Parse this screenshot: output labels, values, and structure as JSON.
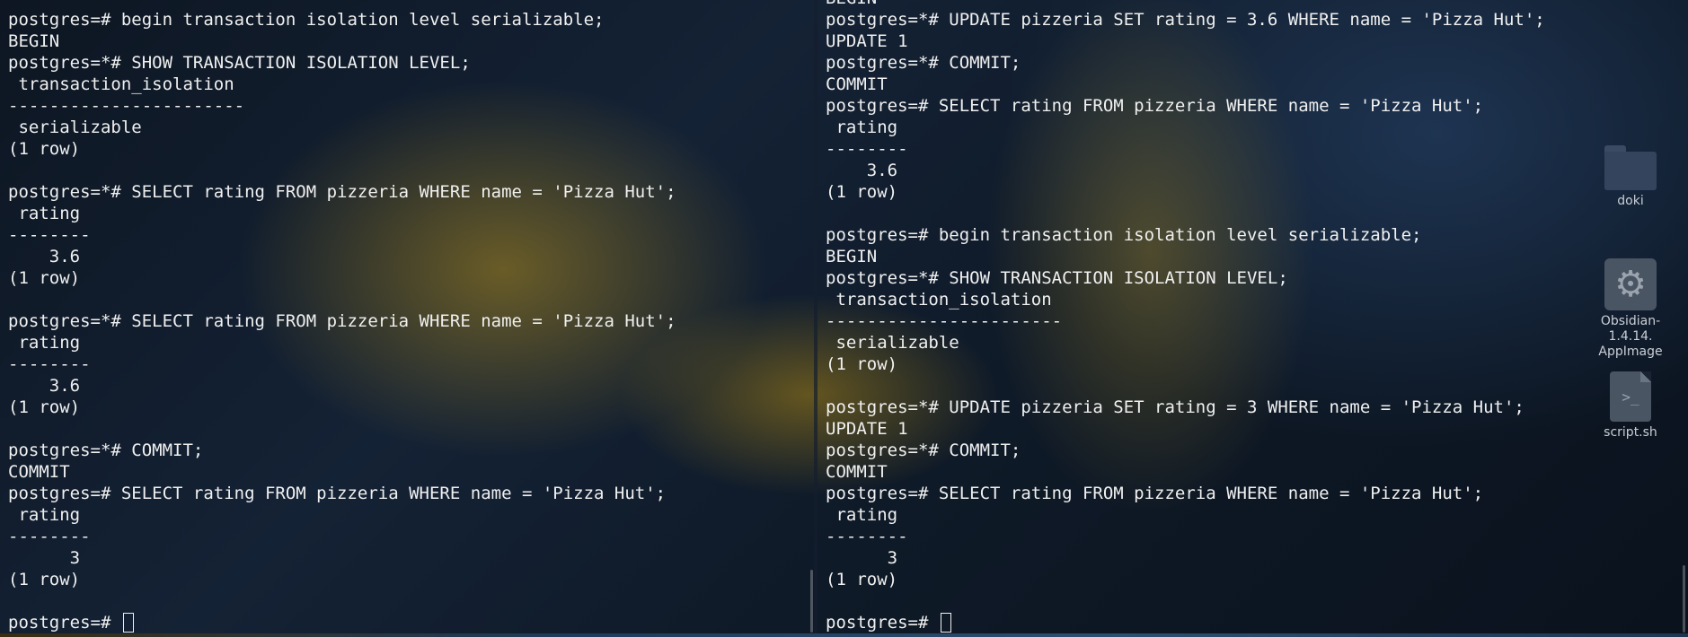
{
  "left_terminal": {
    "lines": [
      "postgres=# begin transaction isolation level serializable;",
      "BEGIN",
      "postgres=*# SHOW TRANSACTION ISOLATION LEVEL;",
      " transaction_isolation",
      "-----------------------",
      " serializable",
      "(1 row)",
      "",
      "postgres=*# SELECT rating FROM pizzeria WHERE name = 'Pizza Hut';",
      " rating",
      "--------",
      "    3.6",
      "(1 row)",
      "",
      "postgres=*# SELECT rating FROM pizzeria WHERE name = 'Pizza Hut';",
      " rating",
      "--------",
      "    3.6",
      "(1 row)",
      "",
      "postgres=*# COMMIT;",
      "COMMIT",
      "postgres=# SELECT rating FROM pizzeria WHERE name = 'Pizza Hut';",
      " rating",
      "--------",
      "      3",
      "(1 row)",
      "",
      "postgres=# "
    ]
  },
  "right_terminal": {
    "lines": [
      "BEGIN",
      "postgres=*# UPDATE pizzeria SET rating = 3.6 WHERE name = 'Pizza Hut';",
      "UPDATE 1",
      "postgres=*# COMMIT;",
      "COMMIT",
      "postgres=# SELECT rating FROM pizzeria WHERE name = 'Pizza Hut';",
      " rating",
      "--------",
      "    3.6",
      "(1 row)",
      "",
      "postgres=# begin transaction isolation level serializable;",
      "BEGIN",
      "postgres=*# SHOW TRANSACTION ISOLATION LEVEL;",
      " transaction_isolation",
      "-----------------------",
      " serializable",
      "(1 row)",
      "",
      "postgres=*# UPDATE pizzeria SET rating = 3 WHERE name = 'Pizza Hut';",
      "UPDATE 1",
      "postgres=*# COMMIT;",
      "COMMIT",
      "postgres=# SELECT rating FROM pizzeria WHERE name = 'Pizza Hut';",
      " rating",
      "--------",
      "      3",
      "(1 row)",
      "",
      "postgres=# "
    ]
  },
  "desktop_icons": [
    {
      "label": "doki",
      "icon": "folder-icon"
    },
    {
      "label": "Obsidian-1.4.14.AppImage",
      "label_line1": "Obsidian-1.4.14.",
      "label_line2": "AppImage",
      "icon": "gear-icon"
    },
    {
      "label": "script.sh",
      "icon": "script-icon",
      "glyph": ">_"
    }
  ]
}
